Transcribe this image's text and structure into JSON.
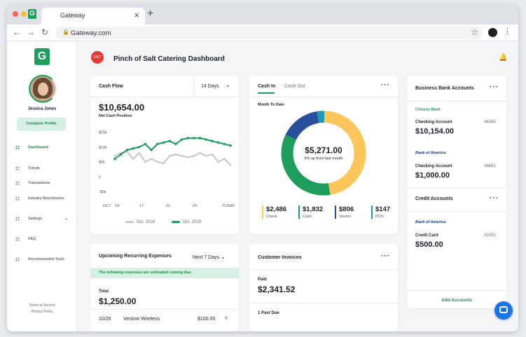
{
  "browser": {
    "tab_title": "Gateway",
    "url": "Gateway.com",
    "favicon_letter": "G"
  },
  "sidebar": {
    "logo_letter": "G",
    "user_name": "Jessica Jones",
    "complete_profile": "Complete Profile",
    "items": [
      {
        "label": "Dashboard",
        "active": true
      },
      {
        "label": "Trends"
      },
      {
        "label": "Transactions"
      },
      {
        "label": "Industry Benchmarks"
      },
      {
        "label": "Settings"
      },
      {
        "label": "FAQ"
      },
      {
        "label": "Recommended Tools"
      }
    ],
    "footer": [
      "Terms of Service",
      "Privacy Policy"
    ]
  },
  "header": {
    "brand_badge": "SALT",
    "title": "Pinch of Salt Catering Dashboard"
  },
  "cash_flow": {
    "title": "Cash Flow",
    "range": "14 Days",
    "amount": "$10,654.00",
    "sublabel": "Net Cash Position",
    "legend": [
      "Oct. 2018",
      "Oct. 2019"
    ]
  },
  "chart_data": {
    "type": "line",
    "x_tick_labels": [
      "OCT",
      "14",
      "17",
      "21",
      "24",
      "TODAY"
    ],
    "y_tick_labels": [
      "$15k",
      "$10k",
      "$5k",
      "0",
      "-$5k"
    ],
    "ylim": [
      -5,
      15
    ],
    "series": [
      {
        "name": "Oct. 2018",
        "color": "#c7c7c7",
        "values": [
          7,
          8,
          8.5,
          6,
          8,
          5,
          6,
          5,
          4.5,
          7,
          7.5,
          7,
          6.5,
          7,
          8,
          7,
          7.5,
          5,
          6,
          4
        ]
      },
      {
        "name": "Oct. 2019",
        "color": "#1f9d5c",
        "values": [
          6,
          7.5,
          9,
          9.5,
          10,
          11,
          9,
          11,
          11.5,
          12,
          11,
          12.5,
          13,
          13,
          13,
          12.5,
          12,
          11.5,
          11,
          10.5
        ]
      }
    ]
  },
  "cash_in": {
    "tabs": [
      "Cash In",
      "Cash Out"
    ],
    "period": "Month To Date",
    "amount": "$5,271.00",
    "sub": "6% up from last month",
    "donut": [
      {
        "label": "Check",
        "value": 2486,
        "color": "#fcc65a"
      },
      {
        "label": "Cash",
        "value": 1832,
        "color": "#1f9d5c"
      },
      {
        "label": "Venmo",
        "value": 806,
        "color": "#2a4f9a"
      },
      {
        "label": "POS",
        "value": 147,
        "color": "#1e9ab8"
      }
    ],
    "breakdown": [
      {
        "value": "$2,486",
        "label": "Check",
        "color": "#fcc65a"
      },
      {
        "value": "$1,832",
        "label": "Cash",
        "color": "#1f9d5c"
      },
      {
        "value": "$806",
        "label": "Venmo",
        "color": "#2a4f9a"
      },
      {
        "value": "$147",
        "label": "POS",
        "color": "#1e9ab8"
      }
    ]
  },
  "bank": {
    "title": "Business Bank Accounts",
    "accounts": [
      {
        "bank": "Citizens Bank",
        "type": "Checking Account",
        "mask": "#6355",
        "amount": "$10,154.00"
      },
      {
        "bank": "Bank of America",
        "type": "Checking Account",
        "mask": "#6652",
        "amount": "$1,000.00"
      }
    ],
    "credit_title": "Credit Accounts",
    "credit": [
      {
        "bank": "Bank of America",
        "type": "Credit Card",
        "mask": "#2251",
        "amount": "$500.00"
      }
    ],
    "add": "Add Accounts"
  },
  "expenses": {
    "title": "Upcoming Recurring Expenses",
    "range": "Next 7 Days",
    "notice": "The following expenses are estimated coming due.",
    "total_label": "Total",
    "total": "$1,250.00",
    "rows": [
      {
        "date": "10/26",
        "name": "Verizon Wireless",
        "amount": "$100.00"
      }
    ]
  },
  "invoices": {
    "title": "Customer Invoices",
    "paid_label": "Paid",
    "paid": "$2,341.52",
    "past_due_label": "1 Past Due"
  }
}
